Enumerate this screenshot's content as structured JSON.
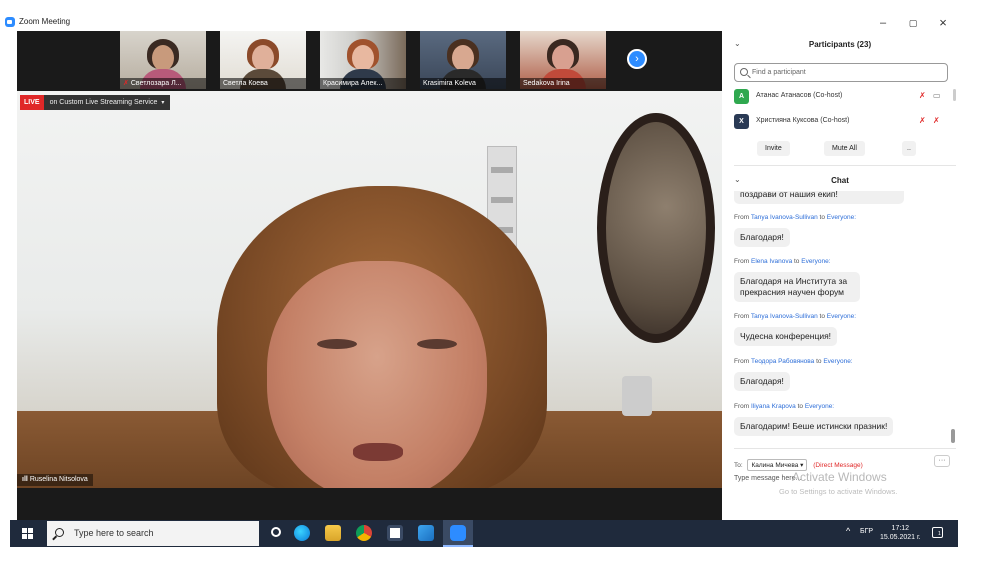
{
  "window": {
    "title": "Zoom Meeting",
    "minimize": "–",
    "maximize": "▢",
    "close": "×"
  },
  "gallery": {
    "thumbnails": [
      {
        "name": "Светлозара Л...",
        "muted": true
      },
      {
        "name": "Светла Коева",
        "muted": false
      },
      {
        "name": "Красимира Алек...",
        "muted": false
      },
      {
        "name": "Krasimira Koleva",
        "muted": false
      },
      {
        "name": "Sedakova Irina",
        "muted": false
      }
    ],
    "next_icon": "›"
  },
  "live": {
    "badge": "LIVE",
    "service": "on Custom Live Streaming Service",
    "caret": "▾"
  },
  "active_speaker": {
    "signal": "ıll",
    "name": "Ruselina Nitsolova"
  },
  "participants": {
    "header": "Participants (23)",
    "chevron": "⌄",
    "search_placeholder": "Find a participant",
    "list": [
      {
        "initial": "A",
        "name": "Атанас Атанасов (Co-host)",
        "color": "#2fa84f"
      },
      {
        "initial": "X",
        "name": "Християна Куксова (Co-host)",
        "color": "#2a3a55"
      }
    ],
    "invite": "Invite",
    "mute_all": "Mute All",
    "more": ".."
  },
  "chat": {
    "header": "Chat",
    "chevron": "⌄",
    "partial_bubble": "поздрави от нашия екип!",
    "messages": [
      {
        "from": "Tanya Ivanova-Sullivan",
        "to": "Everyone:",
        "text": "Благодаря!"
      },
      {
        "from": "Elena Ivanova",
        "to": "Everyone:",
        "text": "Благодаря на Института за прекрасния научен форум"
      },
      {
        "from": "Tanya Ivanova-Sullivan",
        "to": "Everyone:",
        "text": "Чудесна конференция!"
      },
      {
        "from": "Теодора Рабовянова",
        "to": "Everyone:",
        "text": "Благодаря!"
      },
      {
        "from": "Iliyana Krapova",
        "to": "Everyone:",
        "text": "Благодарим! Беше истински празник!"
      }
    ],
    "from_word": "From",
    "to_word": "to",
    "to_label": "To:",
    "recipient": "Калина Мичева ▾",
    "direct_message": "(Direct Message)",
    "more": "···",
    "type_placeholder": "Type message here..."
  },
  "watermark": {
    "line1": "Activate Windows",
    "line2": "Go to Settings to activate Windows."
  },
  "taskbar": {
    "search_text": "Type here to search",
    "tray_chevron": "^",
    "language": "БГР",
    "time": "17:12",
    "date": "15.05.2021 г.",
    "notification_count": "1"
  }
}
